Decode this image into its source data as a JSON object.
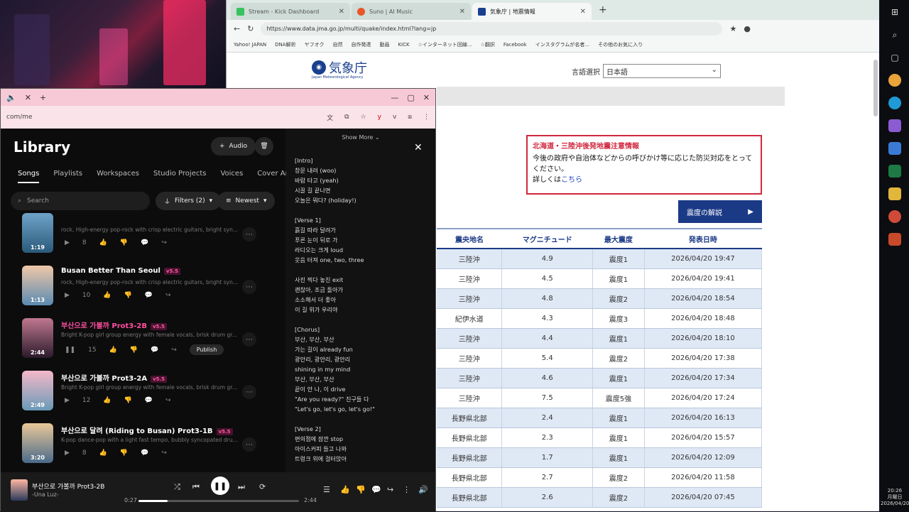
{
  "browser_right": {
    "tabs": [
      {
        "label": "Stream - Kick Dashboard",
        "color": "#36c25e",
        "active": false
      },
      {
        "label": "Suno | AI Music",
        "color": "#e8562a",
        "active": false
      },
      {
        "label": "気象庁 | 地震情報",
        "color": "#1a3f8e",
        "active": true
      }
    ],
    "url": "https://www.data.jma.go.jp/multi/quake/index.html?lang=jp",
    "bookmarks": [
      "Yahoo! JAPAN",
      "DNA解析",
      "ヤフオク",
      "自然",
      "自作発達",
      "動画",
      "KICK",
      "☆インターネット回線...",
      "☆翻訳",
      "Facebook",
      "インスタグラムが名者...",
      "その他のお気に入り"
    ]
  },
  "jma": {
    "logo_name": "気象庁",
    "logo_sub": "Japan Meteorological Agency",
    "lang_label": "言語選択",
    "lang_value": "日本語",
    "alert_title": "北海道・三陸沖後発地震注意情報",
    "alert_body": "今後の政府や自治体などからの呼びかけ等に応じた防災対応をとってください。",
    "alert_more": "詳しくは",
    "alert_link": "こちら",
    "intensity_button": "震度の解説",
    "table_headers": [
      "震央地名",
      "マグニチュード",
      "最大震度",
      "発表日時"
    ],
    "rows": [
      [
        "三陸沖",
        "4.9",
        "震度1",
        "2026/04/20 19:47"
      ],
      [
        "三陸沖",
        "4.5",
        "震度1",
        "2026/04/20 19:41"
      ],
      [
        "三陸沖",
        "4.8",
        "震度2",
        "2026/04/20 18:54"
      ],
      [
        "紀伊水道",
        "4.3",
        "震度3",
        "2026/04/20 18:48"
      ],
      [
        "三陸沖",
        "4.4",
        "震度1",
        "2026/04/20 18:10"
      ],
      [
        "三陸沖",
        "5.4",
        "震度2",
        "2026/04/20 17:38"
      ],
      [
        "三陸沖",
        "4.6",
        "震度1",
        "2026/04/20 17:34"
      ],
      [
        "三陸沖",
        "7.5",
        "震度5強",
        "2026/04/20 17:24"
      ],
      [
        "長野県北部",
        "2.4",
        "震度1",
        "2026/04/20 16:13"
      ],
      [
        "長野県北部",
        "2.3",
        "震度1",
        "2026/04/20 15:57"
      ],
      [
        "長野県北部",
        "1.7",
        "震度1",
        "2026/04/20 12:09"
      ],
      [
        "長野県北部",
        "2.7",
        "震度2",
        "2026/04/20 11:58"
      ],
      [
        "長野県北部",
        "2.6",
        "震度2",
        "2026/04/20 07:45"
      ]
    ]
  },
  "suno": {
    "address": "com/me",
    "library_title": "Library",
    "audio_button": "Audio",
    "nav": [
      "Songs",
      "Playlists",
      "Workspaces",
      "Studio Projects",
      "Voices",
      "Cover Art"
    ],
    "search_placeholder": "Search",
    "filters_label": "Filters (2)",
    "sort_label": "Newest",
    "songs": [
      {
        "title": "",
        "version": "",
        "desc": "rock, High-energy pop-rock with crisp electric guitars, bright syn...",
        "duration": "1:19",
        "count": "8",
        "pink": false,
        "publish": ""
      },
      {
        "title": "Busan Better Than Seoul",
        "version": "v5.5",
        "desc": "rock, High-energy pop-rock with crisp electric guitars, bright syn...",
        "duration": "1:13",
        "count": "10",
        "pink": false,
        "publish": ""
      },
      {
        "title": "부산으로 가볼까   Prot3-2B",
        "version": "v5.5",
        "desc": "Bright K-pop girl group energy with female vocals, brisk drum gr...",
        "duration": "2:44",
        "count": "15",
        "pink": true,
        "publish": "Publish"
      },
      {
        "title": "부산으로 가볼까   Prot3-2A",
        "version": "v5.5",
        "desc": "Bright K-pop girl group energy with female vocals, brisk drum gr...",
        "duration": "2:49",
        "count": "12",
        "pink": false,
        "publish": ""
      },
      {
        "title": "부산으로 달려 (Riding to Busan)   Prot3-1B",
        "version": "v5.5",
        "desc": "K-pop dance-pop with a light fast tempo, bubbly syncopated dru...",
        "duration": "3:20",
        "count": "8",
        "pink": false,
        "publish": ""
      }
    ],
    "lyrics_show_more": "Show More",
    "lyrics": [
      "[Intro]\n창문 내려 (woo)\n바람 타고 (yeah)\n시끌 길 끝나면\n오늘은 뭐다? (holiday!)",
      "[Verse 1]\n흙길 따라 달려가\n푸른 눈이 뒤로 가\n라디오는 크게 loud\n웃음 터져 one, two, three",
      "사진 찍다 놓친 exit\n괜찮아, 조금 돌아가\n소소해서 더 좋아\n이 길 위가 우리야",
      "[Chorus]\n부산, 부산, 부산\n가는 길이 already fun\n광안리, 광안리, 광안리\nshining in my mind\n부산, 부산, 부산\n끝이 안 나, 이 drive\n\"Are you ready?\" 친구들 다\n\"Let's go, let's go, let's go!\"",
      "[Verse 2]\n편의점에 잠깐 stop\n아이스커피 들고 나와\n트렁크 위에 걸터앉아"
    ],
    "player": {
      "title": "부산으로 가볼까   Prot3-2B",
      "artist": "-Una Luz-",
      "current": "0:27",
      "total": "2:44",
      "progress": 0.18
    }
  },
  "taskbar": {
    "time": "20:26",
    "day": "月曜日",
    "date": "2026/04/20"
  }
}
